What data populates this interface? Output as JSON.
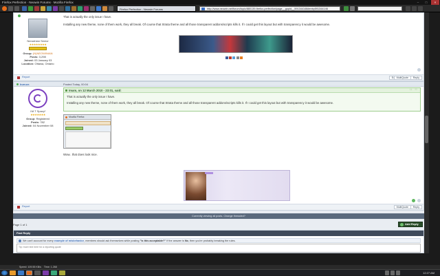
{
  "window": {
    "title": "Firefox Perfection · Neowin Forums · Mozilla Firefox"
  },
  "tabs": [
    {
      "label": "Firefox Perfection - Neowin Forums"
    }
  ],
  "urlbar": {
    "value": "http://www.neowin.net/forum/topic/880139-firefox-perfection/page__gopid__591344146#entry591344146"
  },
  "post1": {
    "text1": "That is actually the only issue I have.",
    "text2": "Installing any new theme, none of them work, they all break. Of course that Strata theme and all those transparent addons/scripts kills it. If I could get this layout but with transparency it would be awesome.",
    "author": {
      "title": "Neowinian Senior",
      "group_label": "Group:",
      "group": "(N)NEOWINIAN",
      "posts_label": "Posts:",
      "posts": "3,298",
      "joined_label": "Joined:",
      "joined": "03 January 03",
      "location_label": "Location:",
      "location": "Ottawa, Ontario"
    },
    "report": "Report",
    "buttons": {
      "edit": "Edit",
      "multiquote": "MultiQuote",
      "reply": "Reply"
    }
  },
  "post2": {
    "author_name": "bunuzr.",
    "posted": "Posted Today, 00:04",
    "quote_header": "Imam, on 12 March 2010 - 23:01, said:",
    "quote1": "That is actually the only issue I have.",
    "quote2": "Installing any new theme, none of them work, they all break. Of course that Strata theme and all those transparent addons/scripts kills it. If I could get this layout but with transparency it would be awesome.",
    "thumb_title": "Mozilla Firefox",
    "reply_text": "Wow.. that does look nice.",
    "author": {
      "title": "I.M.T Spazy*",
      "group_label": "Group:",
      "group": "Registered",
      "posts_label": "Posts:",
      "posts": "782",
      "joined_label": "Joined:",
      "joined": "04 November 08"
    },
    "report": "Report",
    "buttons": {
      "multiquote": "MultiQuote",
      "reply": "Reply"
    }
  },
  "viewing_bar": "Currently viewing all posts. Change threaded?",
  "pagination": "Page 1 of 1",
  "add_reply": "Add Reply",
  "fast_reply": {
    "header": "Fast Reply",
    "notice_pre": "We can't account for every",
    "notice_link": "example of misbehavior",
    "notice_mid": ", members should ask themselves while posting",
    "notice_q": "\"is this acceptable?\"",
    "notice_post": "If the answer is",
    "notice_no": "No",
    "notice_end": ", then you're probably breaking the rules.",
    "placeholder": "Tip: more text here for a reporting quote"
  },
  "statusbar": {
    "speed": "Speed: 109.55 KB/s",
    "time": "Time: 1.268"
  },
  "clock": "12:27 AM",
  "colors": {
    "accent": "#3f6fb5",
    "post_head": "#e3e9f0",
    "add_reply": "#2b4f2b"
  }
}
